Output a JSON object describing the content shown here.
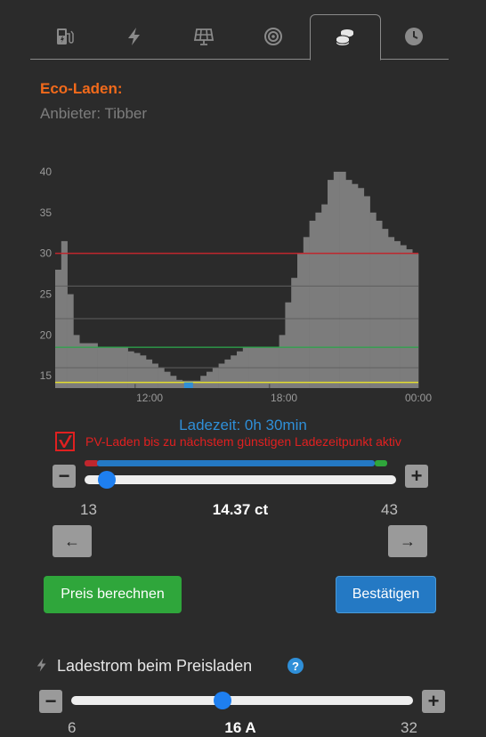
{
  "tabs": [
    {
      "icon": "ev-charger-icon"
    },
    {
      "icon": "lightning-icon"
    },
    {
      "icon": "solar-panel-icon"
    },
    {
      "icon": "target-icon"
    },
    {
      "icon": "coins-icon",
      "active": true
    },
    {
      "icon": "clock-icon"
    }
  ],
  "eco": {
    "title": "Eco-Laden:",
    "provider": "Anbieter: Tibber"
  },
  "chart_data": {
    "type": "bar",
    "y_ticks": [
      "40",
      "35",
      "30",
      "25",
      "20",
      "15"
    ],
    "x_ticks": [
      "12:00",
      "18:00",
      "00:00"
    ],
    "ylim": [
      13.5,
      42.5
    ],
    "values": [
      28,
      31.5,
      25,
      20,
      19,
      19,
      19,
      18.5,
      18.5,
      18.5,
      18.5,
      18.5,
      18,
      17.8,
      17.5,
      17,
      16.5,
      16,
      15.5,
      15,
      14.5,
      14.4,
      14.4,
      14.4,
      15,
      15.5,
      16,
      16.5,
      17,
      17.5,
      18,
      18.5,
      18.5,
      18.5,
      18.5,
      18.5,
      18.5,
      20,
      24,
      27,
      30,
      32,
      34,
      35,
      36,
      39,
      40,
      40,
      39,
      38.5,
      38,
      37,
      35,
      34,
      33,
      32,
      31.5,
      31,
      30.5,
      30
    ],
    "lines": {
      "max_price": 30,
      "selected_price": 14.37,
      "green_line": 18.5,
      "yellow_line": 14.2
    },
    "colors": {
      "bars": "#7c7c7c",
      "max": "#c0262d",
      "green": "#2aa84a",
      "yellow": "#e3dd2f",
      "marker": "#2f8fd8"
    }
  },
  "ladezeit": "Ladezeit: 0h 30min",
  "pv": {
    "checked": true,
    "label": "PV-Laden bis zu nächstem günstigen Ladezeitpunkt aktiv"
  },
  "price_slider": {
    "min": "13",
    "max": "43",
    "value": "14.37 ct",
    "fraction": 0.046,
    "minus": "−",
    "plus": "+"
  },
  "nav": {
    "prev": "←",
    "next": "→"
  },
  "buttons": {
    "calc": "Preis berechnen",
    "confirm": "Bestätigen",
    "calc_color": "#2fa63b",
    "confirm_color": "#2479c4"
  },
  "current": {
    "label": "Ladestrom beim Preisladen",
    "help": "?",
    "minus": "−",
    "plus": "+",
    "fraction": 0.44,
    "min": "6",
    "value": "16 A",
    "max": "32"
  }
}
